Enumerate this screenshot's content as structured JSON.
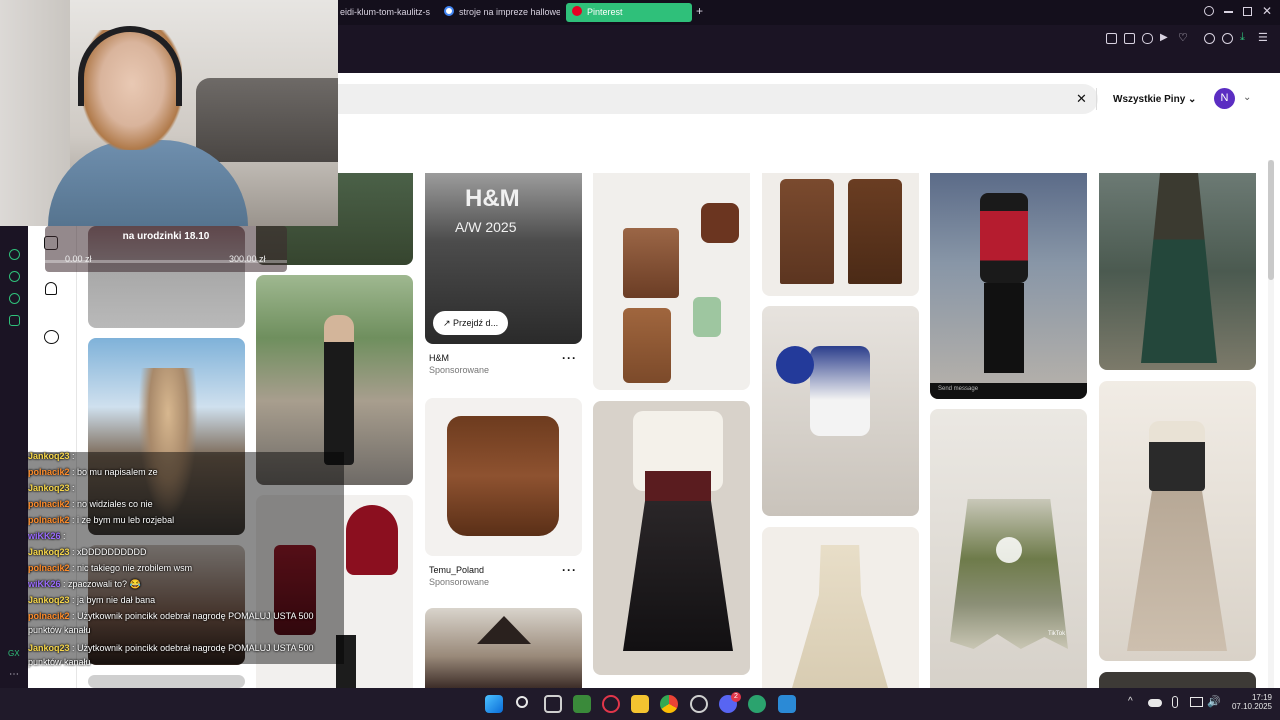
{
  "browser": {
    "tabs": [
      {
        "label": "eidi-klum-tom-kaulitz-s"
      },
      {
        "label": "stroje na impreze hallowe"
      },
      {
        "label": "Pinterest"
      }
    ],
    "new_tab": "+"
  },
  "search": {
    "clear": "✕",
    "filter": "Wszystkie Piny",
    "avatar": "N"
  },
  "goal": {
    "title": "na urodzinki 18.10",
    "current": "0.00 zł",
    "target": "300.00 zł"
  },
  "pins": {
    "hm": {
      "poster_text": "H&M",
      "poster_sub": "A/W 2025",
      "button": "Przejdź d...",
      "brand": "H&M",
      "sponsored": "Sponsorowane",
      "more": "···"
    },
    "temu": {
      "brand": "Temu_Poland",
      "sponsored": "Sponsorowane",
      "more": "···"
    },
    "tiktok": {
      "send": "Send message",
      "watermark": "TikTok"
    }
  },
  "chat": [
    {
      "user": "Jankoq23",
      "sep": " : ",
      "text": "",
      "color": "u1"
    },
    {
      "user": "polnacik2",
      "sep": " : ",
      "text": "bo mu napisalem ze",
      "color": "u2"
    },
    {
      "user": "Jankoq23",
      "sep": " : ",
      "text": "",
      "color": "u1"
    },
    {
      "user": "polnacik2",
      "sep": " : ",
      "text": "no widziales co nie",
      "color": "u2"
    },
    {
      "user": "polnacik2",
      "sep": " : ",
      "text": "i ze bym mu leb rozjebal",
      "color": "u2"
    },
    {
      "user": "wiKK26",
      "sep": " : ",
      "text": "",
      "color": "u3"
    },
    {
      "user": "Jankoq23",
      "sep": " : ",
      "text": "xDDDDDDDDDD",
      "color": "u1"
    },
    {
      "user": "polnacik2",
      "sep": " : ",
      "text": "nic takiego nie zrobilem wsm",
      "color": "u2"
    },
    {
      "user": "wiKK26",
      "sep": " : ",
      "text": "zpaczowali to? 😂",
      "color": "u3"
    },
    {
      "user": "Jankoq23",
      "sep": " : ",
      "text": "ja bym nie dał bana",
      "color": "u1"
    },
    {
      "user": "polnacik2",
      "sep": " : ",
      "text": "Użytkownik poincikk odebrał nagrodę POMALUJ USTA 500",
      "color": "u2"
    },
    {
      "user": "",
      "sep": "",
      "text": "punktów kanału",
      "color": "u2"
    },
    {
      "user": "Jankoq23",
      "sep": " : ",
      "text": "Użytkownik poincikk odebrał nagrodę POMALUJ USTA 500",
      "color": "u1"
    },
    {
      "user": "",
      "sep": "",
      "text": "punktów kanału",
      "color": "u1"
    }
  ],
  "taskbar": {
    "time": "17:19",
    "date": "07.10.2025",
    "badge": "2"
  },
  "colors": {
    "accent": "#2fc07a",
    "pinterest_red": "#e60023",
    "avatar": "#5b2dc2"
  }
}
